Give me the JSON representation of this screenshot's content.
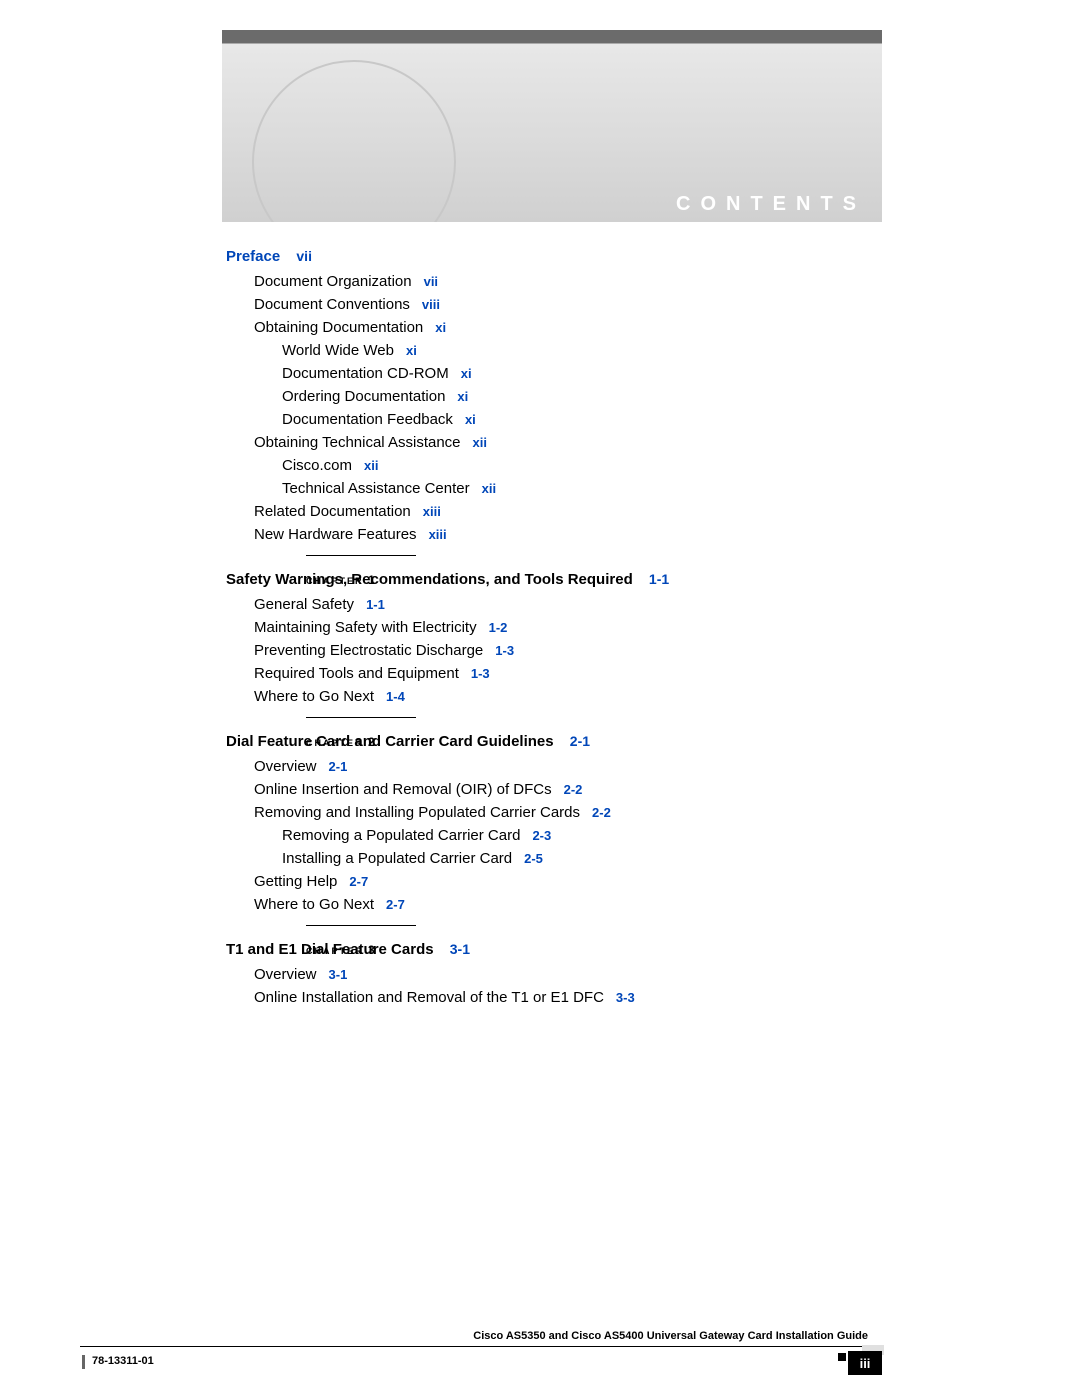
{
  "banner_label": "CONTENTS",
  "preface": {
    "title": "Preface",
    "page": "vii",
    "items": [
      {
        "t": "Document Organization",
        "p": "vii"
      },
      {
        "t": "Document Conventions",
        "p": "viii"
      },
      {
        "t": "Obtaining Documentation",
        "p": "xi"
      },
      {
        "t": "World Wide Web",
        "p": "xi",
        "ind": 2
      },
      {
        "t": "Documentation CD-ROM",
        "p": "xi",
        "ind": 2
      },
      {
        "t": "Ordering Documentation",
        "p": "xi",
        "ind": 2
      },
      {
        "t": "Documentation Feedback",
        "p": "xi",
        "ind": 2
      },
      {
        "t": "Obtaining Technical Assistance",
        "p": "xii"
      },
      {
        "t": "Cisco.com",
        "p": "xii",
        "ind": 2
      },
      {
        "t": "Technical Assistance Center",
        "p": "xii",
        "ind": 2
      },
      {
        "t": "Related Documentation",
        "p": "xiii"
      },
      {
        "t": "New Hardware Features",
        "p": "xiii"
      }
    ]
  },
  "ch1": {
    "label": "CHAPTER",
    "num": "1",
    "title": "Safety Warnings, Recommendations, and Tools Required",
    "page": "1-1",
    "items": [
      {
        "t": "General Safety",
        "p": "1-1"
      },
      {
        "t": "Maintaining Safety with Electricity",
        "p": "1-2"
      },
      {
        "t": "Preventing Electrostatic Discharge",
        "p": "1-3"
      },
      {
        "t": "Required Tools and Equipment",
        "p": "1-3"
      },
      {
        "t": "Where to Go Next",
        "p": "1-4"
      }
    ]
  },
  "ch2": {
    "label": "CHAPTER",
    "num": "2",
    "title": "Dial Feature Card and Carrier Card Guidelines",
    "page": "2-1",
    "items": [
      {
        "t": "Overview",
        "p": "2-1"
      },
      {
        "t": "Online Insertion and Removal (OIR) of DFCs",
        "p": "2-2"
      },
      {
        "t": "Removing and Installing Populated Carrier Cards",
        "p": "2-2"
      },
      {
        "t": "Removing a Populated Carrier Card",
        "p": "2-3",
        "ind": 2
      },
      {
        "t": "Installing a Populated Carrier Card",
        "p": "2-5",
        "ind": 2
      },
      {
        "t": "Getting Help",
        "p": "2-7"
      },
      {
        "t": "Where to Go Next",
        "p": "2-7"
      }
    ]
  },
  "ch3": {
    "label": "CHAPTER",
    "num": "3",
    "title": "T1 and E1 Dial Feature Cards",
    "page": "3-1",
    "items": [
      {
        "t": "Overview",
        "p": "3-1"
      },
      {
        "t": "Online Installation and Removal of the T1 or E1 DFC",
        "p": "3-3"
      }
    ]
  },
  "footer": {
    "title": "Cisco AS5350 and Cisco AS5400 Universal Gateway Card Installation Guide",
    "docnum": "78-13311-01",
    "pagenum": "iii"
  }
}
